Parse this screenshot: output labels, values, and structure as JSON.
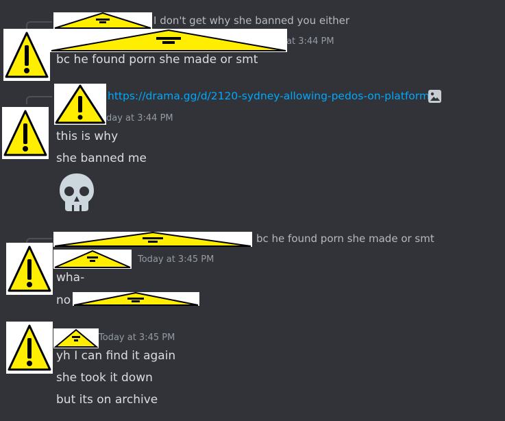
{
  "messages": [
    {
      "reply_preview": "I don't get why she banned you either",
      "timestamp_partial": "at 3:44 PM",
      "lines": [
        "bc he found porn she made or smt"
      ]
    },
    {
      "link": "https://drama.gg/d/2120-sydney-allowing-pedos-on-platform",
      "link_icon": "image-icon",
      "timestamp_partial": "day at 3:44 PM",
      "lines": [
        "this is why",
        "she banned me"
      ],
      "emoji": "skull-emoji"
    },
    {
      "reply_preview": "bc he found porn she made or smt",
      "timestamp": "Today at 3:45 PM",
      "lines": [
        "wha-",
        "no"
      ]
    },
    {
      "timestamp": "Today at 3:45 PM",
      "lines": [
        "yh I can find it again",
        "she took it down",
        "but its on archive"
      ]
    }
  ],
  "icons": {
    "avatar": "warning-sign-icon",
    "redaction": "warning-sign-icon"
  },
  "colors": {
    "background": "#313338",
    "text": "#dbdee1",
    "muted": "#949ba4",
    "link": "#00a8fc",
    "warning_yellow": "#ffee00"
  }
}
